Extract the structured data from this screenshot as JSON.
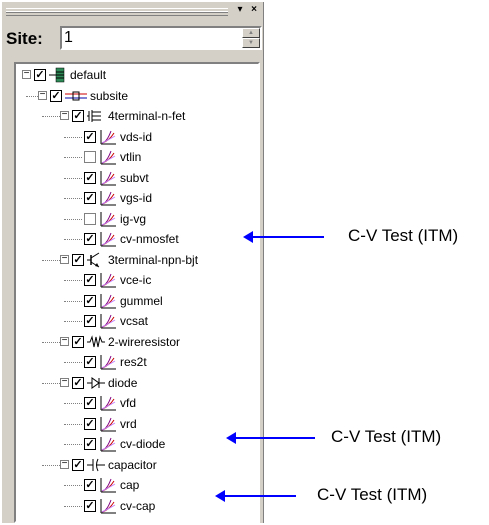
{
  "panel": {
    "close_glyph": "×",
    "menu_glyph": "▾"
  },
  "site": {
    "label": "Site:",
    "value": "1"
  },
  "tree": {
    "root": {
      "label": "default",
      "checked": true
    },
    "subsite": {
      "label": "subsite",
      "checked": true
    },
    "nodes": [
      {
        "label": "4terminal-n-fet",
        "checked": true,
        "icon": "fet-icon"
      },
      {
        "label": "vds-id",
        "checked": true,
        "icon": "test-icon"
      },
      {
        "label": "vtlin",
        "checked": false,
        "icon": "test-icon"
      },
      {
        "label": "subvt",
        "checked": true,
        "icon": "test-icon"
      },
      {
        "label": "vgs-id",
        "checked": true,
        "icon": "test-icon"
      },
      {
        "label": "ig-vg",
        "checked": false,
        "icon": "test-icon"
      },
      {
        "label": "cv-nmosfet",
        "checked": true,
        "icon": "test-icon"
      },
      {
        "label": "3terminal-npn-bjt",
        "checked": true,
        "icon": "bjt-icon"
      },
      {
        "label": "vce-ic",
        "checked": true,
        "icon": "test-icon"
      },
      {
        "label": "gummel",
        "checked": true,
        "icon": "test-icon"
      },
      {
        "label": "vcsat",
        "checked": true,
        "icon": "test-icon"
      },
      {
        "label": "2-wireresistor",
        "checked": true,
        "icon": "resistor-icon"
      },
      {
        "label": "res2t",
        "checked": true,
        "icon": "test-icon"
      },
      {
        "label": "diode",
        "checked": true,
        "icon": "diode-icon"
      },
      {
        "label": "vfd",
        "checked": true,
        "icon": "test-icon"
      },
      {
        "label": "vrd",
        "checked": true,
        "icon": "test-icon"
      },
      {
        "label": "cv-diode",
        "checked": true,
        "icon": "test-icon"
      },
      {
        "label": "capacitor",
        "checked": true,
        "icon": "capacitor-icon"
      },
      {
        "label": "cap",
        "checked": true,
        "icon": "test-icon"
      },
      {
        "label": "cv-cap",
        "checked": true,
        "icon": "test-icon"
      }
    ]
  },
  "annotations": [
    {
      "text": "C-V Test (ITM)",
      "color": "#0000ff"
    },
    {
      "text": "C-V Test (ITM)",
      "color": "#0000ff"
    },
    {
      "text": "C-V Test (ITM)",
      "color": "#0000ff"
    }
  ]
}
